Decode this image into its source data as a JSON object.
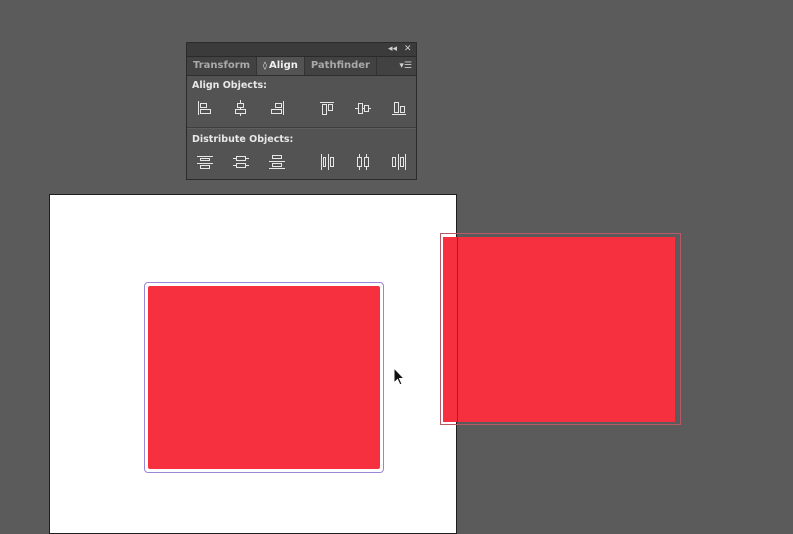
{
  "panel": {
    "collapse_glyph": "◂◂",
    "close_glyph": "✕",
    "menu_glyph": "▾☰",
    "tabs": [
      {
        "label": "Transform",
        "active": false
      },
      {
        "label": "Align",
        "active": true,
        "prefix": "◊"
      },
      {
        "label": "Pathfinder",
        "active": false
      }
    ],
    "align_objects_label": "Align Objects:",
    "distribute_objects_label": "Distribute Objects:",
    "align_buttons": [
      "horizontal-align-left-icon",
      "horizontal-align-center-icon",
      "horizontal-align-right-icon",
      "vertical-align-top-icon",
      "vertical-align-center-icon",
      "vertical-align-bottom-icon"
    ],
    "distribute_buttons": [
      "vertical-distribute-top-icon",
      "vertical-distribute-center-icon",
      "vertical-distribute-bottom-icon",
      "horizontal-distribute-left-icon",
      "horizontal-distribute-center-icon",
      "horizontal-distribute-right-icon"
    ]
  },
  "colors": {
    "canvas": "#5b5b5b",
    "artboard": "#ffffff",
    "shape_fill": "#f73040",
    "selection": "#9a86d6"
  }
}
